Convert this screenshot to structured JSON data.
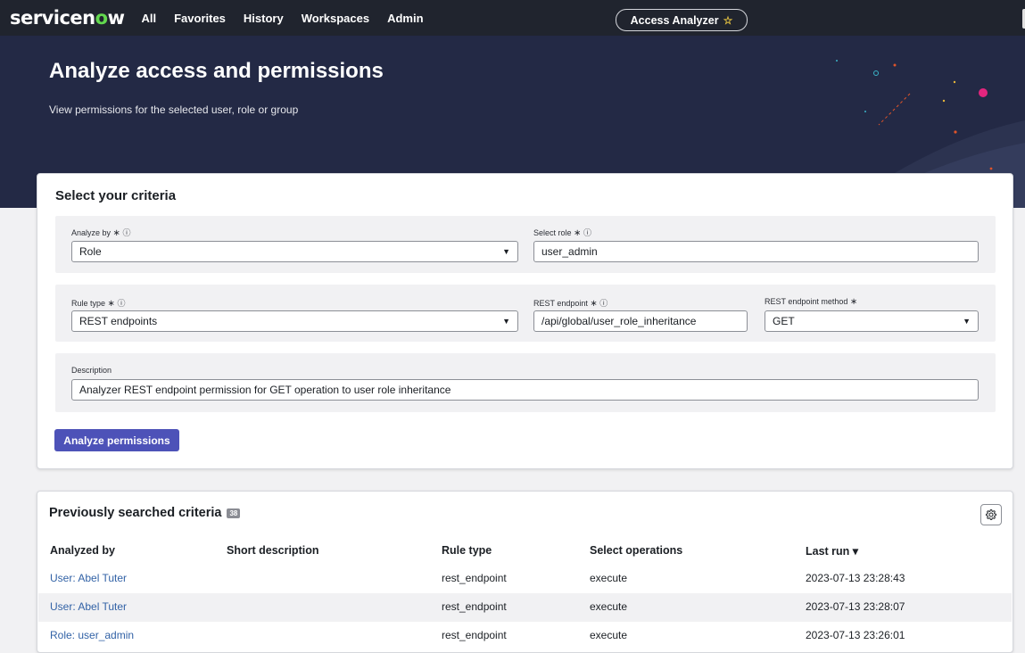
{
  "nav": {
    "logo_pre": "servicen",
    "logo_o": "o",
    "logo_post": "w",
    "links": [
      "All",
      "Favorites",
      "History",
      "Workspaces",
      "Admin"
    ],
    "pill_label": "Access Analyzer"
  },
  "hero": {
    "title": "Analyze access and permissions",
    "subtitle": "View permissions for the selected user, role or group"
  },
  "criteria": {
    "heading": "Select your criteria",
    "analyze_by": {
      "label": "Analyze by",
      "value": "Role"
    },
    "select_role": {
      "label": "Select role",
      "value": "user_admin"
    },
    "rule_type": {
      "label": "Rule type",
      "value": "REST endpoints"
    },
    "rest_endpoint": {
      "label": "REST endpoint",
      "value": "/api/global/user_role_inheritance"
    },
    "rest_method": {
      "label": "REST endpoint method",
      "value": "GET"
    },
    "description": {
      "label": "Description",
      "value": "Analyzer REST endpoint permission for GET operation to user role inheritance"
    },
    "required_mark": "∗",
    "info_mark": "ⓘ",
    "analyze_button": "Analyze permissions"
  },
  "previous": {
    "heading": "Previously searched criteria",
    "count": "38",
    "columns": [
      "Analyzed by",
      "Short description",
      "Rule type",
      "Select operations",
      "Last run ▾"
    ],
    "rows": [
      {
        "analyzed_by": "User: Abel Tuter",
        "short_description": "",
        "rule_type": "rest_endpoint",
        "operations": "execute",
        "last_run": "2023-07-13 23:28:43"
      },
      {
        "analyzed_by": "User: Abel Tuter",
        "short_description": "",
        "rule_type": "rest_endpoint",
        "operations": "execute",
        "last_run": "2023-07-13 23:28:07"
      },
      {
        "analyzed_by": "Role: user_admin",
        "short_description": "",
        "rule_type": "rest_endpoint",
        "operations": "execute",
        "last_run": "2023-07-13 23:26:01"
      }
    ]
  },
  "colors": {
    "nav_bg": "#20242e",
    "hero_bg": "#232945",
    "primary_button": "#4d52b8",
    "link": "#3262a6",
    "logo_accent": "#62d84e"
  }
}
